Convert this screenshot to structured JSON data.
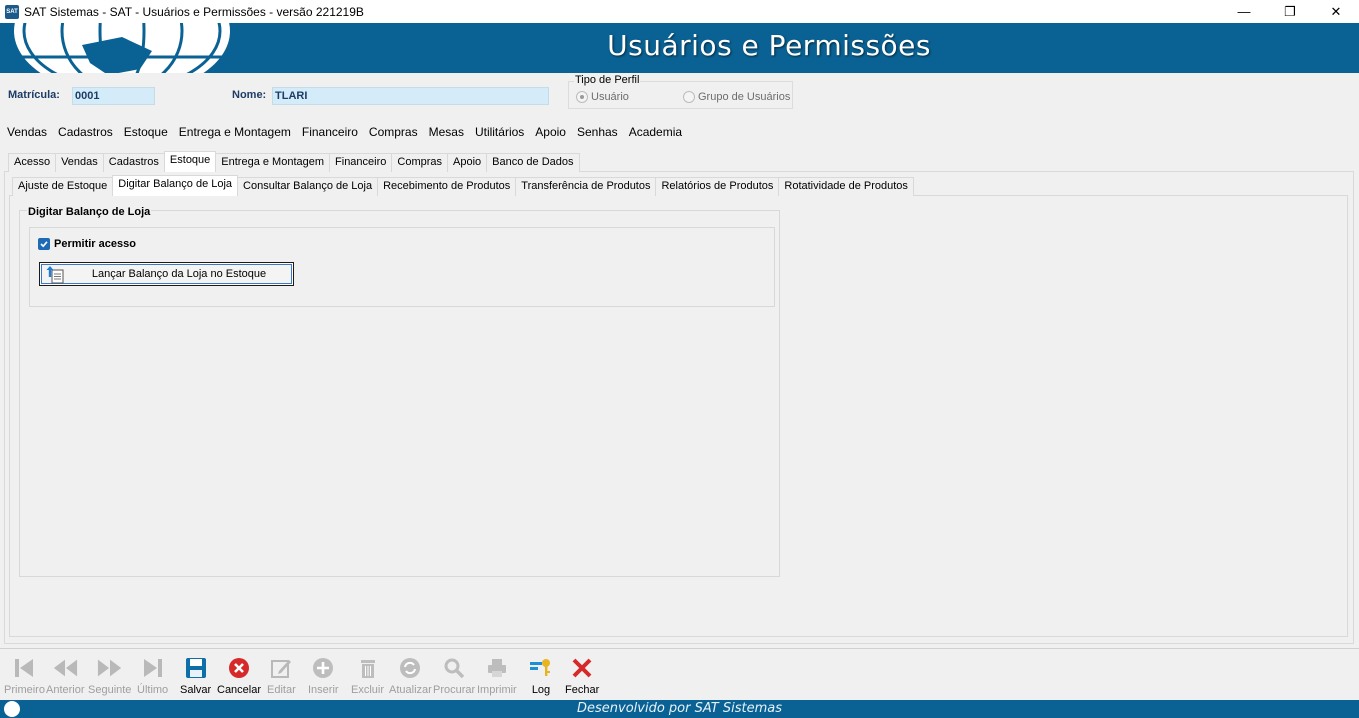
{
  "window": {
    "title": "SAT Sistemas - SAT - Usuários e Permissões - versão 221219B",
    "app_icon_text": "SAT",
    "minimize": "—",
    "maximize": "❐",
    "close": "✕"
  },
  "banner": {
    "title": "Usuários e Permissões",
    "color": "#0a6294"
  },
  "header": {
    "matricula_label": "Matrícula:",
    "matricula_value": "0001",
    "nome_label": "Nome:",
    "nome_value": "TLARI",
    "perfil": {
      "legend": "Tipo de Perfil",
      "option_usuario": "Usuário",
      "option_grupo": "Grupo de Usuários",
      "selected": "Usuário"
    }
  },
  "menu": {
    "items": [
      "Vendas",
      "Cadastros",
      "Estoque",
      "Entrega e Montagem",
      "Financeiro",
      "Compras",
      "Mesas",
      "Utilitários",
      "Apoio",
      "Senhas",
      "Academia"
    ]
  },
  "tabs_level1": {
    "items": [
      "Acesso",
      "Vendas",
      "Cadastros",
      "Estoque",
      "Entrega e Montagem",
      "Financeiro",
      "Compras",
      "Apoio",
      "Banco de Dados"
    ],
    "active": "Estoque"
  },
  "tabs_level2": {
    "items": [
      "Ajuste de Estoque",
      "Digitar Balanço de Loja",
      "Consultar Balanço de Loja",
      "Recebimento de Produtos",
      "Transferência de Produtos",
      "Relatórios de Produtos",
      "Rotatividade de Produtos"
    ],
    "active": "Digitar Balanço de Loja"
  },
  "panel": {
    "title": "Digitar Balanço de Loja",
    "permitir_label": "Permitir acesso",
    "permitir_checked": true,
    "action_button": "Lançar Balanço da Loja no Estoque"
  },
  "toolbar": {
    "primeiro": "Primeiro",
    "anterior": "Anterior",
    "seguinte": "Seguinte",
    "ultimo": "Último",
    "salvar": "Salvar",
    "cancelar": "Cancelar",
    "editar": "Editar",
    "inserir": "Inserir",
    "excluir": "Excluir",
    "atualizar": "Atualizar",
    "procurar": "Procurar",
    "imprimir": "Imprimir",
    "log": "Log",
    "fechar": "Fechar"
  },
  "status": {
    "text": "Desenvolvido por SAT Sistemas"
  }
}
